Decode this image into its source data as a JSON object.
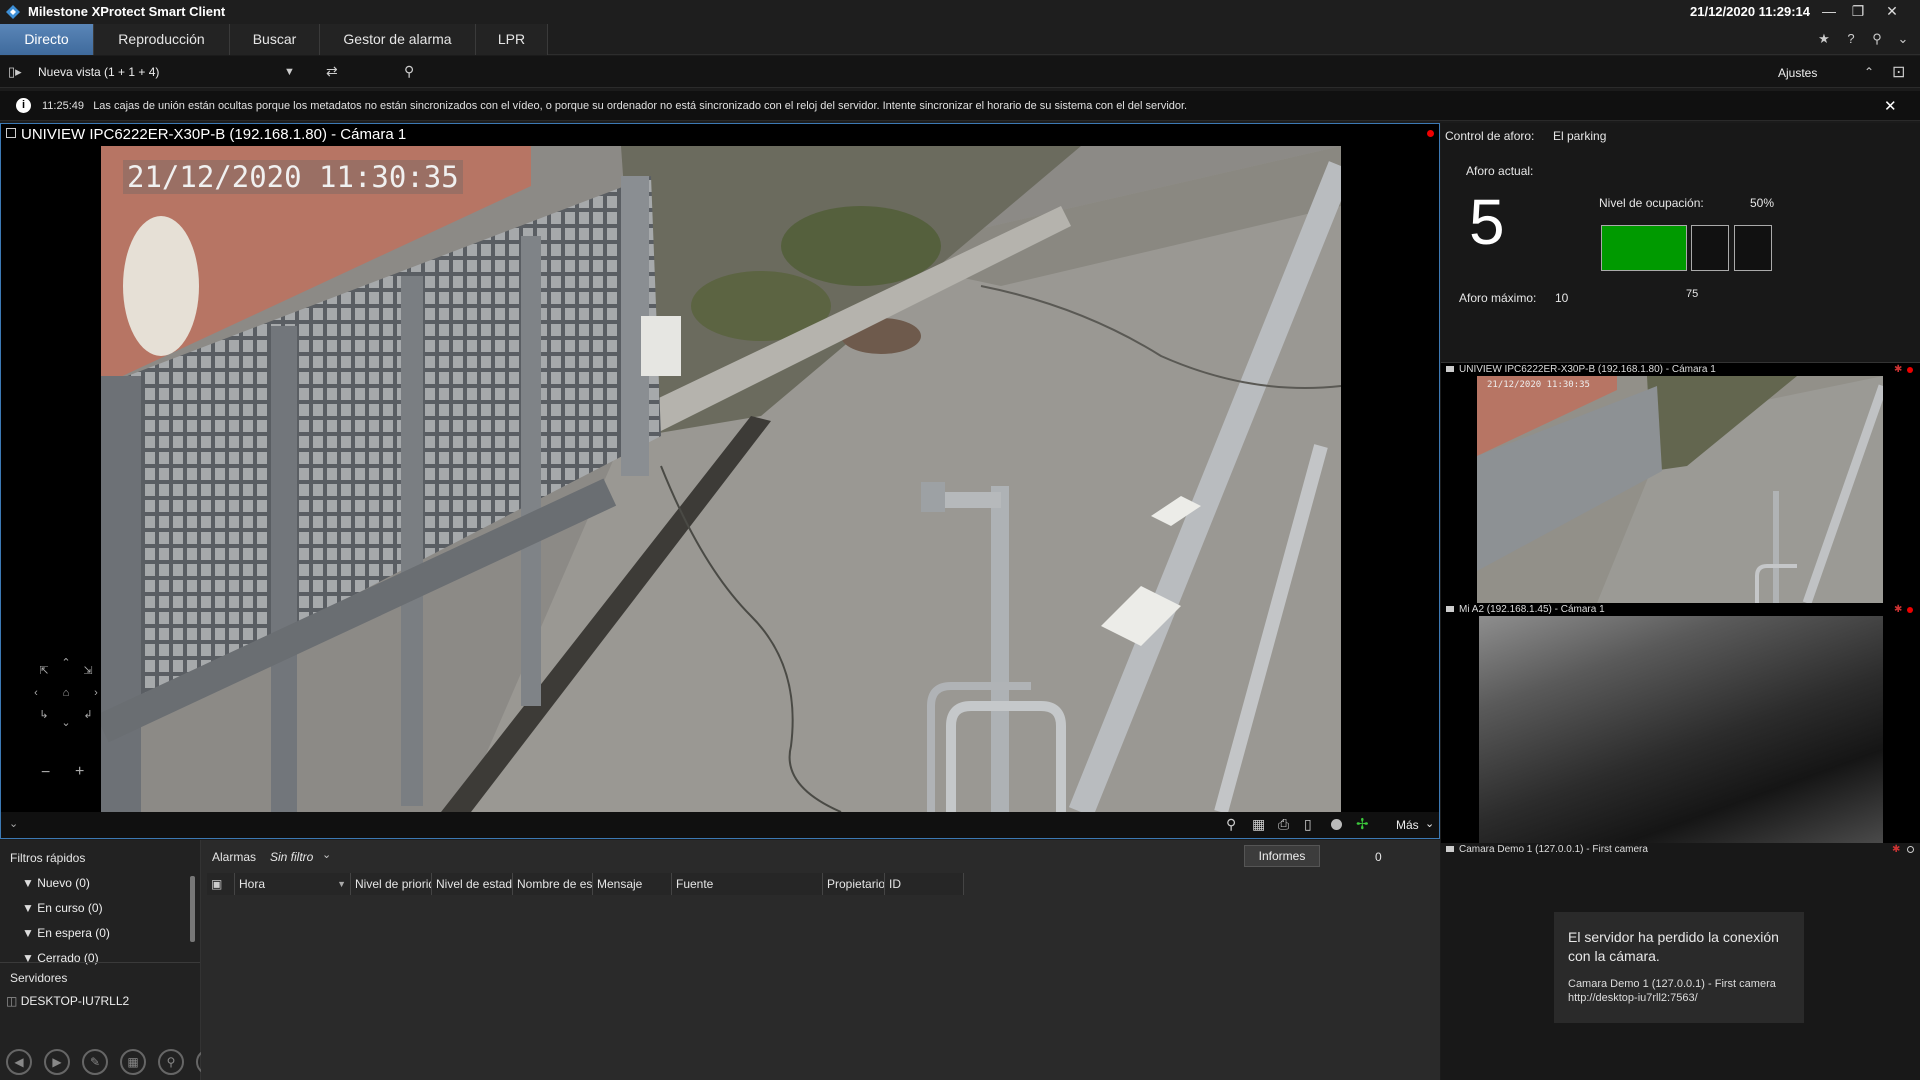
{
  "app": {
    "title": "Milestone XProtect Smart Client",
    "datetime": "21/12/2020 11:29:14"
  },
  "tabs": [
    {
      "label": "Directo",
      "active": true
    },
    {
      "label": "Reproducción"
    },
    {
      "label": "Buscar"
    },
    {
      "label": "Gestor de alarma"
    },
    {
      "label": "LPR"
    }
  ],
  "viewbar": {
    "view_name": "Nueva vista (1 + 1 + 4)",
    "settings_label": "Ajustes"
  },
  "notification": {
    "time": "11:25:49",
    "message": "Las cajas de unión están ocultas porque los metadatos no están sincronizados con el vídeo, o porque su ordenador no está sincronizado con el reloj del servidor. Intente sincronizar el horario de su sistema con el del servidor."
  },
  "main_camera": {
    "title": "UNIVIEW IPC6222ER-X30P-B (192.168.1.80) - Cámara 1",
    "osd_timestamp": "21/12/2020 11:30:35",
    "more_label": "Más"
  },
  "occupancy": {
    "control_label": "Control de aforo:",
    "location": "El parking",
    "current_label": "Aforo actual:",
    "current_value": "5",
    "level_label": "Nivel de ocupación:",
    "level_percent": "50%",
    "level_fill_fraction": 0.5,
    "level_marker": "75",
    "max_label": "Aforo máximo:",
    "max_value": "10",
    "fill_color": "#009a00"
  },
  "side_cameras": [
    {
      "title": "UNIVIEW IPC6222ER-X30P-B (192.168.1.80) - Cámara 1",
      "osd": "21/12/2020 11:30:35"
    },
    {
      "title": "Mi A2 (192.168.1.45) - Cámara 1"
    },
    {
      "title": "Camara Demo 1 (127.0.0.1) - First camera"
    }
  ],
  "connection_lost": {
    "message": "El servidor ha perdido la conexión con la cámara.",
    "camera": "Camara Demo 1 (127.0.0.1) - First camera",
    "url": "http://desktop-iu7rll2:7563/"
  },
  "quick_filters": {
    "title": "Filtros rápidos",
    "items": [
      "Nuevo (0)",
      "En curso (0)",
      "En espera (0)",
      "Cerrado (0)"
    ]
  },
  "servers": {
    "title": "Servidores",
    "items": [
      "DESKTOP-IU7RLL2"
    ]
  },
  "alarms": {
    "title": "Alarmas",
    "filter": "Sin filtro",
    "reports_label": "Informes",
    "count": "0",
    "columns": [
      "Hora",
      "Nivel de priorid",
      "Nivel de estado",
      "Nombre de est",
      "Mensaje",
      "Fuente",
      "Propietario",
      "ID"
    ]
  }
}
